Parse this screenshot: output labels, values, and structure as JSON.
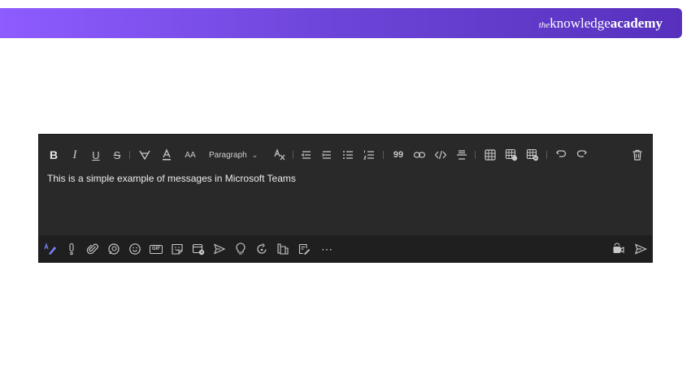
{
  "brand": {
    "prefix": "the",
    "word1": "knowledge",
    "word2": "academy"
  },
  "toolbar": {
    "bold": "B",
    "italic": "I",
    "underline": "U",
    "strikethrough": "S",
    "font_size": "AA",
    "paragraph_label": "Paragraph",
    "paragraph_chevron": "⌄",
    "quote": "99"
  },
  "message": {
    "text": "This is a simple example of messages in Microsoft Teams"
  },
  "actions": {
    "gif_label": "GIF",
    "more": "⋯"
  },
  "colors": {
    "brand_gradient_start": "#8f5cff",
    "brand_gradient_end": "#5731bd",
    "composer_bg": "#292929",
    "action_bar_bg": "#1f1f1f",
    "icon": "#c8c8c8",
    "accent_format_icon": "#7c83ff"
  }
}
